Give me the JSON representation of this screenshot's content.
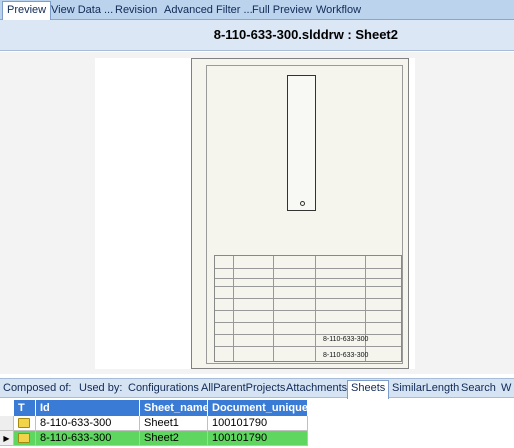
{
  "top_tabs": [
    "Preview",
    "View Data ...",
    "Revision",
    "Advanced Filter ...",
    "Full Preview",
    "Workflow"
  ],
  "document_title": "8-110-633-300.slddrw : Sheet2",
  "drawing": {
    "doc_number": "8-110-633-300"
  },
  "bottom_tabs": [
    "Composed of:",
    "Used by:",
    "Configurations",
    "AllParentProjects",
    "Attachments",
    "Sheets",
    "SimilarLength",
    "Search",
    "W"
  ],
  "active_bottom_tab": "Sheets",
  "grid": {
    "columns": [
      "T",
      "Id",
      "Sheet_name",
      "Document_unique..."
    ],
    "rows": [
      {
        "id": "8-110-633-300",
        "sheet_name": "Sheet1",
        "doc_unique": "100101790",
        "selected": false,
        "icon": "folder-icon"
      },
      {
        "id": "8-110-633-300",
        "sheet_name": "Sheet2",
        "doc_unique": "100101790",
        "selected": true,
        "icon": "folder-icon"
      }
    ]
  },
  "colors": {
    "tab_strip": "#bcd3ee",
    "grid_header": "#3a7bd5",
    "selected_row": "#5fd65f"
  }
}
